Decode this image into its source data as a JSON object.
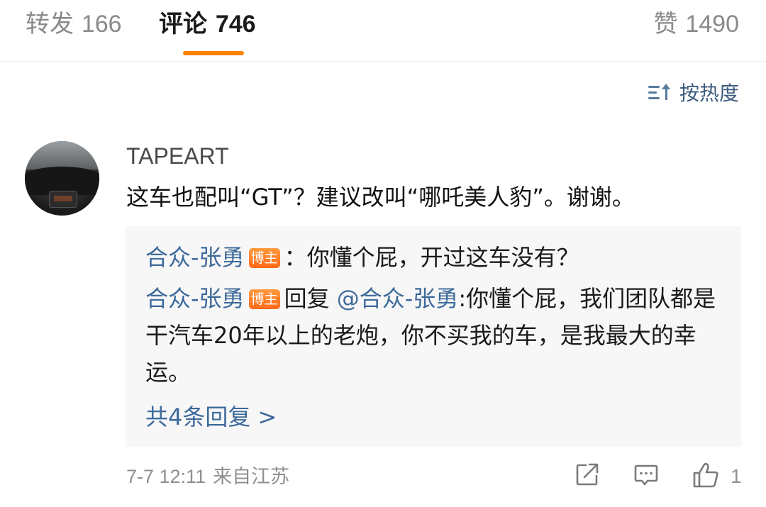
{
  "tabs": {
    "repost": {
      "label": "转发",
      "count": "166"
    },
    "comments": {
      "label": "评论",
      "count": "746"
    },
    "likes": {
      "label": "赞",
      "count": "1490"
    }
  },
  "sort": {
    "label": "按热度",
    "icon": "sort-hot-icon"
  },
  "comment": {
    "username": "TAPEART",
    "text": "这车也配叫“GT”？建议改叫“哪吒美人豹”。谢谢。",
    "time": "7-7 12:11",
    "location": "来自江苏",
    "like_count": "1"
  },
  "replies": [
    {
      "author": "合众-张勇",
      "badge": "博主",
      "separator": "：",
      "text": "你懂个屁，开过这车没有？"
    },
    {
      "author": "合众-张勇",
      "badge": "博主",
      "reply_word": "回复",
      "mention": "@合众-张勇",
      "text": ":你懂个屁，我们团队都是干汽车20年以上的老炮，你不买我的车，是我最大的幸运。"
    }
  ],
  "more_replies": "共4条回复 >",
  "colors": {
    "accent": "#ff8200",
    "link": "#3d6a9b",
    "badge": "#ff6a1a",
    "reply_bg": "#f7f7f7"
  },
  "icons": {
    "share": "share-icon",
    "comment": "comment-icon",
    "like": "thumbs-up-icon"
  }
}
